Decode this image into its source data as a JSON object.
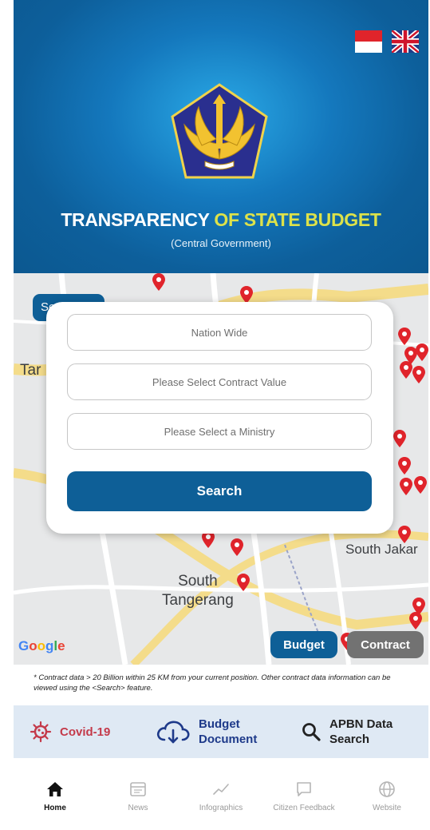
{
  "header": {
    "title_part1": "TRANSPARENCY",
    "title_part2": "OF STATE BUDGET",
    "subtitle": "(Central Government)"
  },
  "languages": [
    {
      "name": "indonesian-flag-icon"
    },
    {
      "name": "uk-flag-icon"
    }
  ],
  "map": {
    "labels": {
      "tangerang_partial": "Tar",
      "south_jakarta": "South Jakar",
      "south_tangerang": "South\nTangerang"
    },
    "provider": "Google",
    "hidden_tab_label": "Se",
    "toggle": {
      "budget": "Budget",
      "contract": "Contract"
    }
  },
  "search_form": {
    "region": "Nation Wide",
    "contract_value": "Please Select Contract Value",
    "ministry": "Please Select a Ministry",
    "button": "Search"
  },
  "note": "* Contract data > 20 Billion within 25 KM from your current position. Other contract data information can be viewed using the <Search> feature.",
  "quick_links": {
    "covid": "Covid-19",
    "budget_document": "Budget Document",
    "apbn_search": "APBN Data Search"
  },
  "nav": {
    "home": "Home",
    "news": "News",
    "infographics": "Infographics",
    "citizen_feedback": "Citizen Feedback",
    "website": "Website"
  },
  "colors": {
    "brand_blue": "#0e5f97",
    "title_yellow": "#dde24a",
    "pin_red": "#e0242b",
    "covid_red": "#c43a4a"
  }
}
